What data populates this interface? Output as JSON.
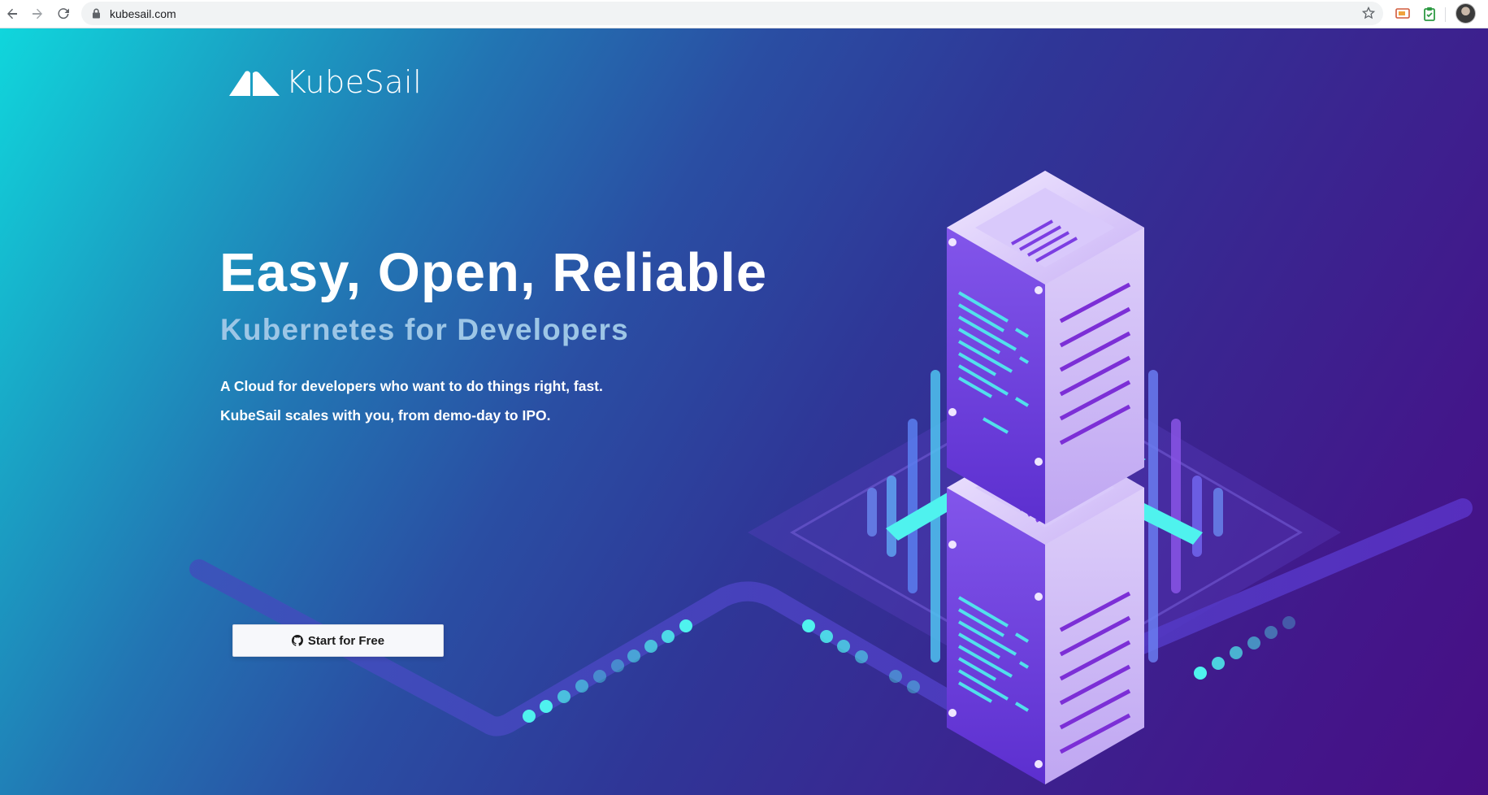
{
  "browser": {
    "url": "kubesail.com"
  },
  "brand": {
    "name": "KubeSail"
  },
  "hero": {
    "headline": "Easy, Open, Reliable",
    "subheadline": "Kubernetes for Developers",
    "tagline_1": "A Cloud for developers who want to do things right, fast.",
    "tagline_2": "KubeSail scales with you, from demo-day to IPO.",
    "cta_label": "Start for Free"
  },
  "colors": {
    "gradient_start": "#10d6dc",
    "gradient_end": "#470f84",
    "subheadline": "#9dc6e6",
    "accent_cyan": "#4ff2ee",
    "server_purple": "#7a3ee0"
  }
}
